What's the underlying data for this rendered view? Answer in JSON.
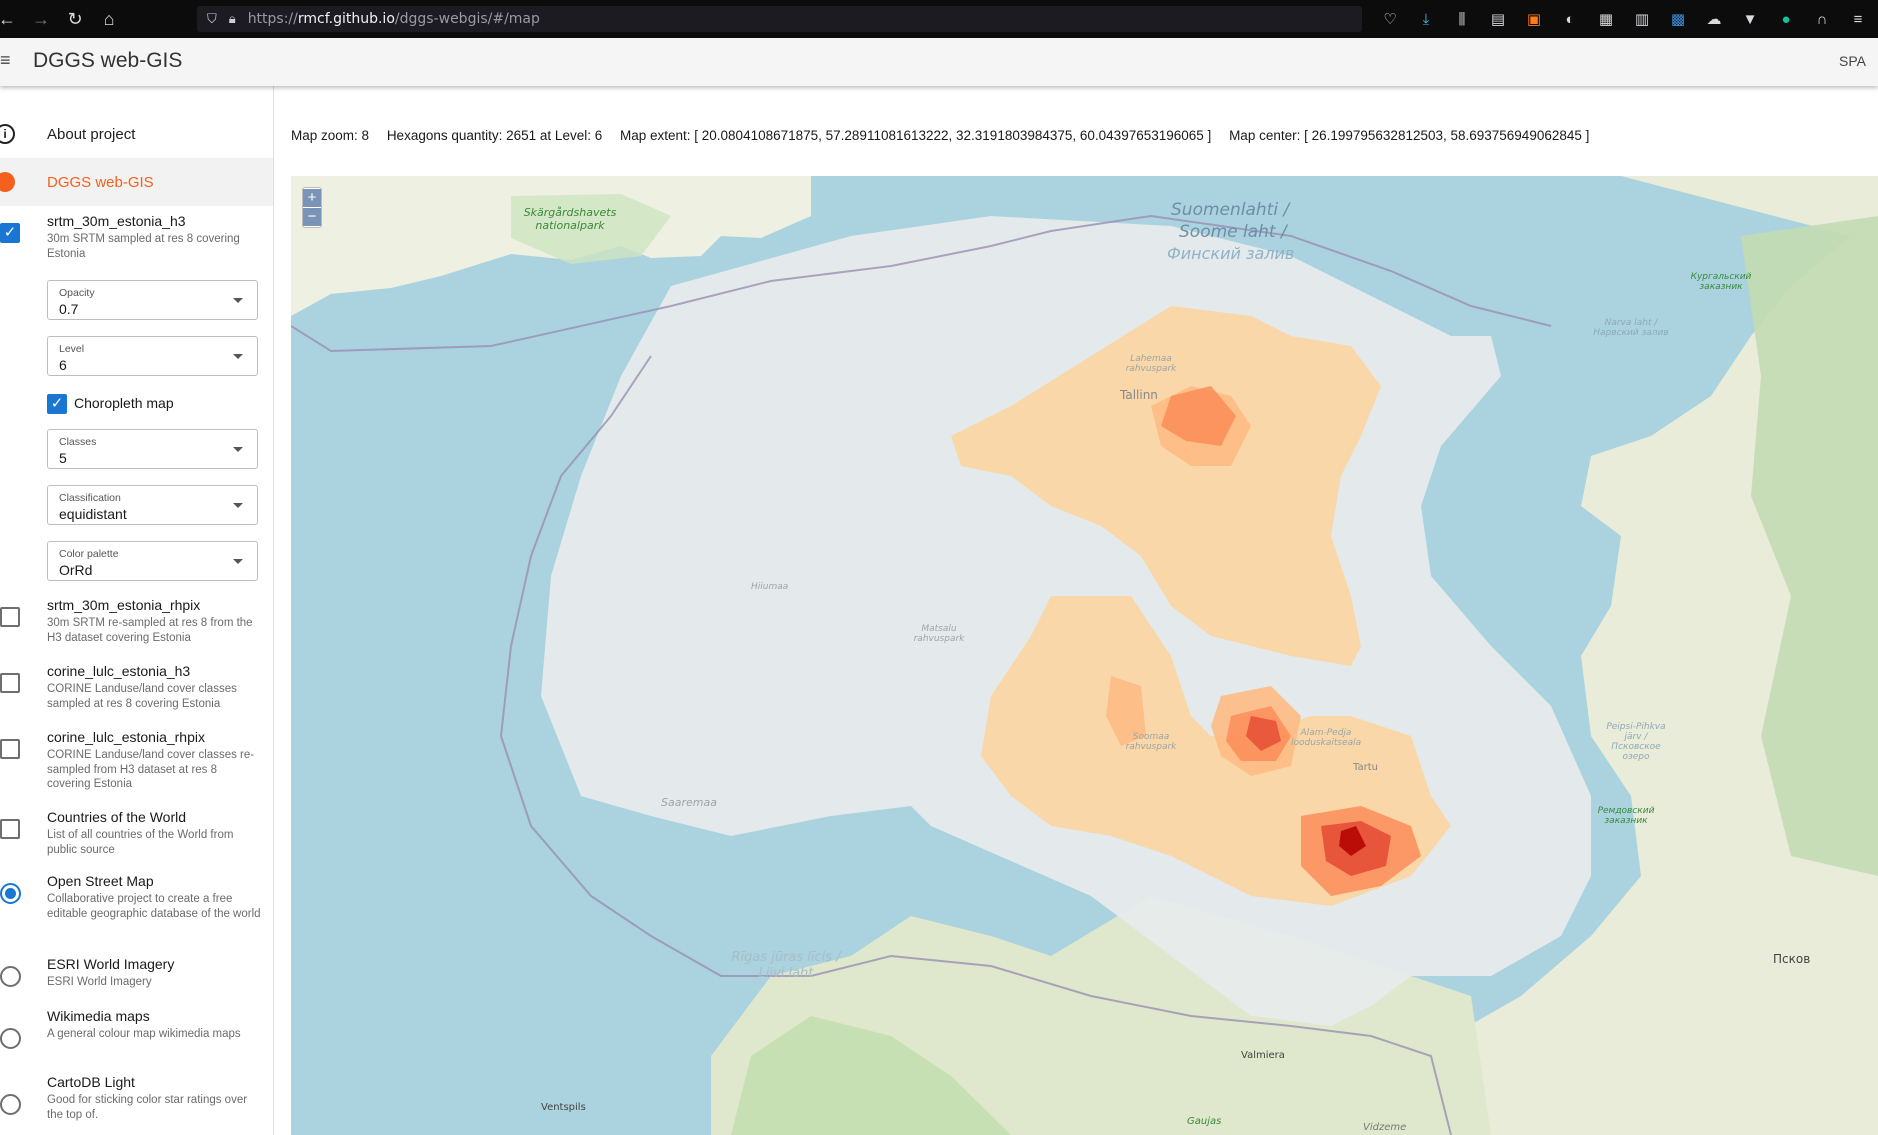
{
  "browser": {
    "url_prefix": "https://",
    "url_host": "rmcf.github.io",
    "url_path": "/dggs-webgis/#/map"
  },
  "app": {
    "title": "DGGS web-GIS",
    "spa": "SPA"
  },
  "nav": {
    "about": "About project",
    "dggs": "DGGS web-GIS"
  },
  "layers": [
    {
      "title": "srtm_30m_estonia_h3",
      "desc": "30m SRTM sampled at res 8 covering Estonia",
      "checked": true
    },
    {
      "title": "srtm_30m_estonia_rhpix",
      "desc": "30m SRTM re-sampled at res 8 from the H3 dataset covering Estonia",
      "checked": false
    },
    {
      "title": "corine_lulc_estonia_h3",
      "desc": "CORINE Landuse/land cover classes sampled at res 8 covering Estonia",
      "checked": false
    },
    {
      "title": "corine_lulc_estonia_rhpix",
      "desc": "CORINE Landuse/land cover classes re-sampled from H3 dataset at res 8 covering Estonia",
      "checked": false
    },
    {
      "title": "Countries of the World",
      "desc": "List of all countries of the World from public source",
      "checked": false
    }
  ],
  "controls": {
    "opacity": {
      "label": "Opacity",
      "value": "0.7"
    },
    "level": {
      "label": "Level",
      "value": "6"
    },
    "choropleth": {
      "label": "Choropleth map",
      "checked": true
    },
    "classes": {
      "label": "Classes",
      "value": "5"
    },
    "classification": {
      "label": "Classification",
      "value": "equidistant"
    },
    "palette": {
      "label": "Color palette",
      "value": "OrRd"
    }
  },
  "basemaps": [
    {
      "title": "Open Street Map",
      "desc": "Collaborative project to create a free editable geographic database of the world",
      "selected": true
    },
    {
      "title": "ESRI World Imagery",
      "desc": "ESRI World Imagery",
      "selected": false
    },
    {
      "title": "Wikimedia maps",
      "desc": "A general colour map wikimedia maps",
      "selected": false
    },
    {
      "title": "CartoDB Light",
      "desc": "Good for sticking color star ratings over the top of.",
      "selected": false
    }
  ],
  "info": {
    "zoom": "Map zoom: 8",
    "hexagons": "Hexagons quantity: 2651 at Level: 6",
    "extent": "Map extent: [ 20.0804108671875, 57.28911081613222, 32.3191803984375, 60.04397653196065 ]",
    "center": "Map center: [ 26.199795632812503, 58.693756949062845 ]"
  },
  "map": {
    "zoom_in": "+",
    "zoom_out": "−",
    "labels": {
      "skargardshavets": "Skärgårdshavets nationalpark",
      "suomenlahti": "Suomenlahti /",
      "soome": "Soome laht /",
      "finsky": "Финский залив",
      "kurgalsky": "Кургальский заказник",
      "narva_laht": "Narva laht / Нарвский залив",
      "tallinn": "Tallinn",
      "lahemaa": "Lahemaa rahvuspark",
      "hiiumaa": "Hiiumaa",
      "matsalu": "Matsalu rahvuspark",
      "soomaa": "Soomaa rahvuspark",
      "alam_pedja": "Alam-Pedja looduskaitseala",
      "tartu": "Tartu",
      "peipsi": "Peipsi-Pihkva järv / Псковское озеро",
      "remdovsky": "Ремдовский заказник",
      "saaremaa": "Saaremaa",
      "riga_gulf": "Rīgas jūras līcis / Liivi laht",
      "pskov": "Псков",
      "valmiera": "Valmiera",
      "ventspils": "Ventspils",
      "gauja": "Gaujas",
      "vidzeme": "Vidzeme"
    },
    "colors": {
      "sea": "#aad3df",
      "land": "#eef0e2",
      "hex_mask": "#e9ecec",
      "class1": "#fdd49e",
      "class2": "#fdbb84",
      "class3": "#fc8d59",
      "class4": "#e34a33",
      "class5": "#b30000"
    }
  }
}
